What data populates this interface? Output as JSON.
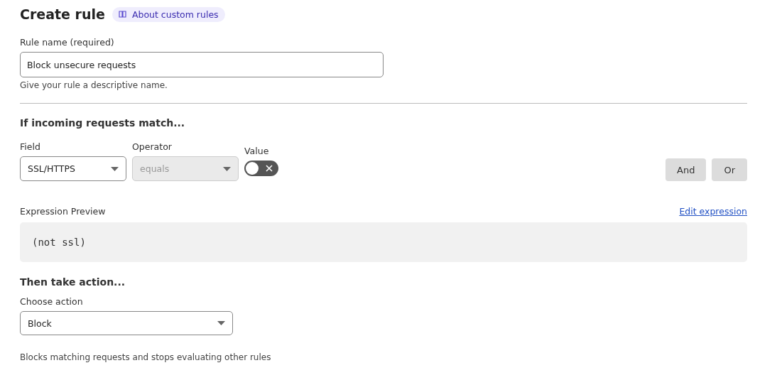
{
  "header": {
    "title": "Create rule",
    "help_link": "About custom rules"
  },
  "rule_name": {
    "label": "Rule name (required)",
    "value": "Block unsecure requests",
    "hint": "Give your rule a descriptive name."
  },
  "match": {
    "heading": "If incoming requests match...",
    "field": {
      "label": "Field",
      "value": "SSL/HTTPS",
      "disabled": false
    },
    "operator": {
      "label": "Operator",
      "value": "equals",
      "disabled": true
    },
    "value": {
      "label": "Value",
      "on": false
    },
    "buttons": [
      "And",
      "Or"
    ]
  },
  "expression": {
    "label": "Expression Preview",
    "edit_link": "Edit expression",
    "code": "(not ssl)"
  },
  "action": {
    "heading": "Then take action...",
    "label": "Choose action",
    "value": "Block",
    "description": "Blocks matching requests and stops evaluating other rules"
  }
}
